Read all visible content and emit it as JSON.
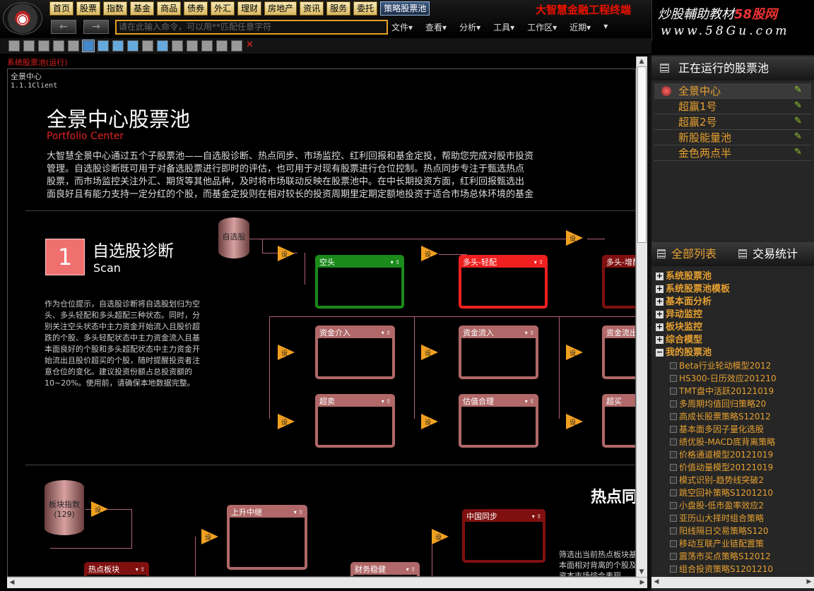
{
  "topmenu": [
    "首页",
    "股票",
    "指数",
    "基金",
    "商品",
    "债券",
    "外汇",
    "理财",
    "房地产",
    "资讯",
    "服务",
    "委托",
    "策略股票池"
  ],
  "brand": "大智慧金融工程终端",
  "ad": {
    "line1a": "炒股輔助教材",
    "line1b": "58股网",
    "url": "www.58Gu.com"
  },
  "command": {
    "placeholder": "请在此输入命令，可以用**匹配任意字符"
  },
  "menu2": [
    "文件▾",
    "查看▾",
    "分析▾",
    "工具▾",
    "工作区▾",
    "近期▾",
    "▾"
  ],
  "caption": "系统股票池(运行)",
  "main": {
    "crumb1": "全景中心",
    "crumb2": "1.1.1Client",
    "title": "全景中心股票池",
    "subtitle": "Portfolio Center",
    "intro": [
      "大智慧全景中心通过五个子股票池——自选股诊断、热点同步、市场监控、红利回报和基金定投，帮助您完成对股市投资",
      "管理。自选股诊断既可用于对备选股票进行即时的评估，也可用于对现有股票进行仓位控制。热点同步专注于甄选热点",
      "股票，而市场监控关注外汇、期货等其他品种，及时将市场联动反映在股票池中。在中长期投资方面，红利回报甄选出",
      "面良好且有能力支持一定分红的个股，而基金定投则在相对较长的投资周期里定期定额地投资于适合市场总体环境的基金"
    ],
    "section1": {
      "num": "1",
      "title": "自选股诊断",
      "sub": "Scan",
      "desc": "作为仓位提示，自选股诊断将自选股划归为空头、多头轻配和多头超配三种状态。同时，分别关注空头状态中主力资金开始流入且股价超跌的个股、多头轻配状态中主力资金流入且基本面良好的个股和多头超配状态中主力资金开始流出且股价超买的个股，随时提醒投资者注意仓位的变化。建议投资份额占总投资额的10~20%。使用前，请确保本地数据完整。"
    },
    "flow1": {
      "source": "自选股",
      "tri_label": "设",
      "boxes": [
        "空头",
        "多头-轻配",
        "多头-增配",
        "资金介入",
        "资金流入",
        "资金流出",
        "超卖",
        "估值合理",
        "超买"
      ]
    },
    "section2": {
      "title": "热点同",
      "source": "板块指数\n(129)",
      "boxes": [
        "上升中继",
        "中国同步",
        "热点板块",
        "财务稳健"
      ],
      "desc": "筛选出当前热点板块基本面相对背离的个股及资本市场综合表现"
    },
    "box_ctrl": "▾ ⇧"
  },
  "right": {
    "running_title": "正在运行的股票池",
    "pools": [
      "全景中心",
      "超赢1号",
      "超赢2号",
      "新股能量池",
      "金色两点半"
    ],
    "tabs": [
      "全部列表",
      "交易统计"
    ],
    "tree_nodes": [
      {
        "pm": "+",
        "label": "系统股票池"
      },
      {
        "pm": "+",
        "label": "系统股票池模板"
      },
      {
        "pm": "+",
        "label": "基本面分析"
      },
      {
        "pm": "+",
        "label": "异动监控"
      },
      {
        "pm": "+",
        "label": "板块监控"
      },
      {
        "pm": "+",
        "label": "综合模型"
      },
      {
        "pm": "−",
        "label": "我的股票池"
      }
    ],
    "tree_leaves": [
      "Beta行业轮动模型2012",
      "HS300-日历效应201210",
      "TMT盘中活跃20121019",
      "多周期均值回归策略20",
      "高成长股票策略S12012",
      "基本面多因子量化选股",
      "绩优股-MACD底背离策略",
      "价格通道模型20121019",
      "价值动量模型20121019",
      "模式识别-趋势线突破2",
      "跳空回补策略S1201210",
      "小盘股-低市盈率效应2",
      "亚历山大择时组合策略",
      "阳线隔日交易策略S120",
      "移动互联产业链配置策",
      "震荡市买点策略S12012",
      "组合投资策略S1201210"
    ]
  }
}
